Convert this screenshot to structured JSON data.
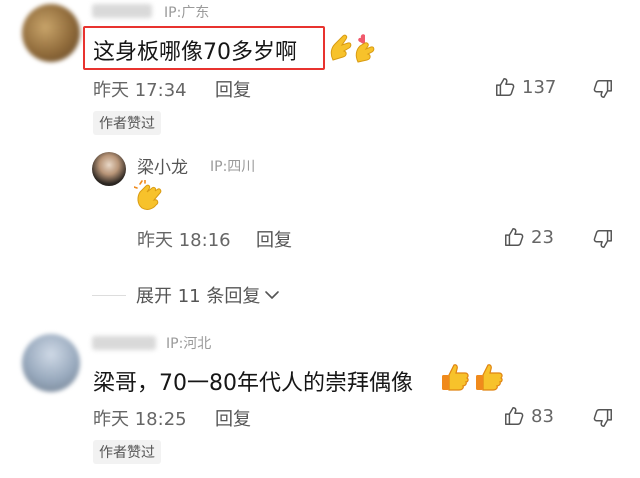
{
  "comments": [
    {
      "ip": "IP:广东",
      "text": "这身板哪像70多岁啊",
      "time": "昨天 17:34",
      "reply_label": "回复",
      "likes": "137",
      "author_liked": "作者赞过",
      "emoji": [
        "pinched-hand-heart",
        "pinched-hand-heart"
      ]
    },
    {
      "ip": "IP:河北",
      "text": "梁哥，70一80年代人的崇拜偶像",
      "time": "昨天 18:25",
      "reply_label": "回复",
      "likes": "83",
      "author_liked": "作者赞过",
      "emoji": [
        "thumbs-up",
        "thumbs-up"
      ]
    }
  ],
  "reply": {
    "username": "梁小龙",
    "ip": "IP:四川",
    "emoji": "clapping-hands",
    "time": "昨天 18:16",
    "reply_label": "回复",
    "likes": "23"
  },
  "expand_label": "展开 11 条回复",
  "colors": {
    "highlight": "#e8332f",
    "emoji_yellow": "#f7c22b",
    "emoji_orange": "#f08a1c"
  }
}
